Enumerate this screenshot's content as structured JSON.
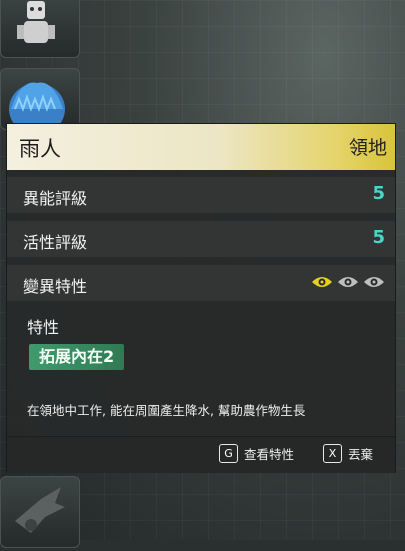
{
  "creature": {
    "name": "雨人",
    "status": "領地"
  },
  "stats": [
    {
      "label": "異能評級",
      "value": "5"
    },
    {
      "label": "活性評級",
      "value": "5"
    }
  ],
  "mutation": {
    "label": "變異特性",
    "indicators": [
      {
        "icon": "eye-icon",
        "color": "#e4d21e",
        "active": true
      },
      {
        "icon": "eye-icon",
        "color": "#bfbfbf",
        "active": false
      },
      {
        "icon": "eye-icon",
        "color": "#bfbfbf",
        "active": false
      }
    ]
  },
  "traits": {
    "title": "特性",
    "items": [
      "拓展內在2"
    ],
    "description": "在領地中工作, 能在周圍產生降水, 幫助農作物生長"
  },
  "footer": {
    "view_key": "G",
    "view_label": "查看特性",
    "discard_key": "X",
    "discard_label": "丟棄"
  },
  "colors": {
    "header_accent": "#e4d46a",
    "stat_value": "#45d7c8",
    "trait_chip": "#3f9b6c"
  }
}
